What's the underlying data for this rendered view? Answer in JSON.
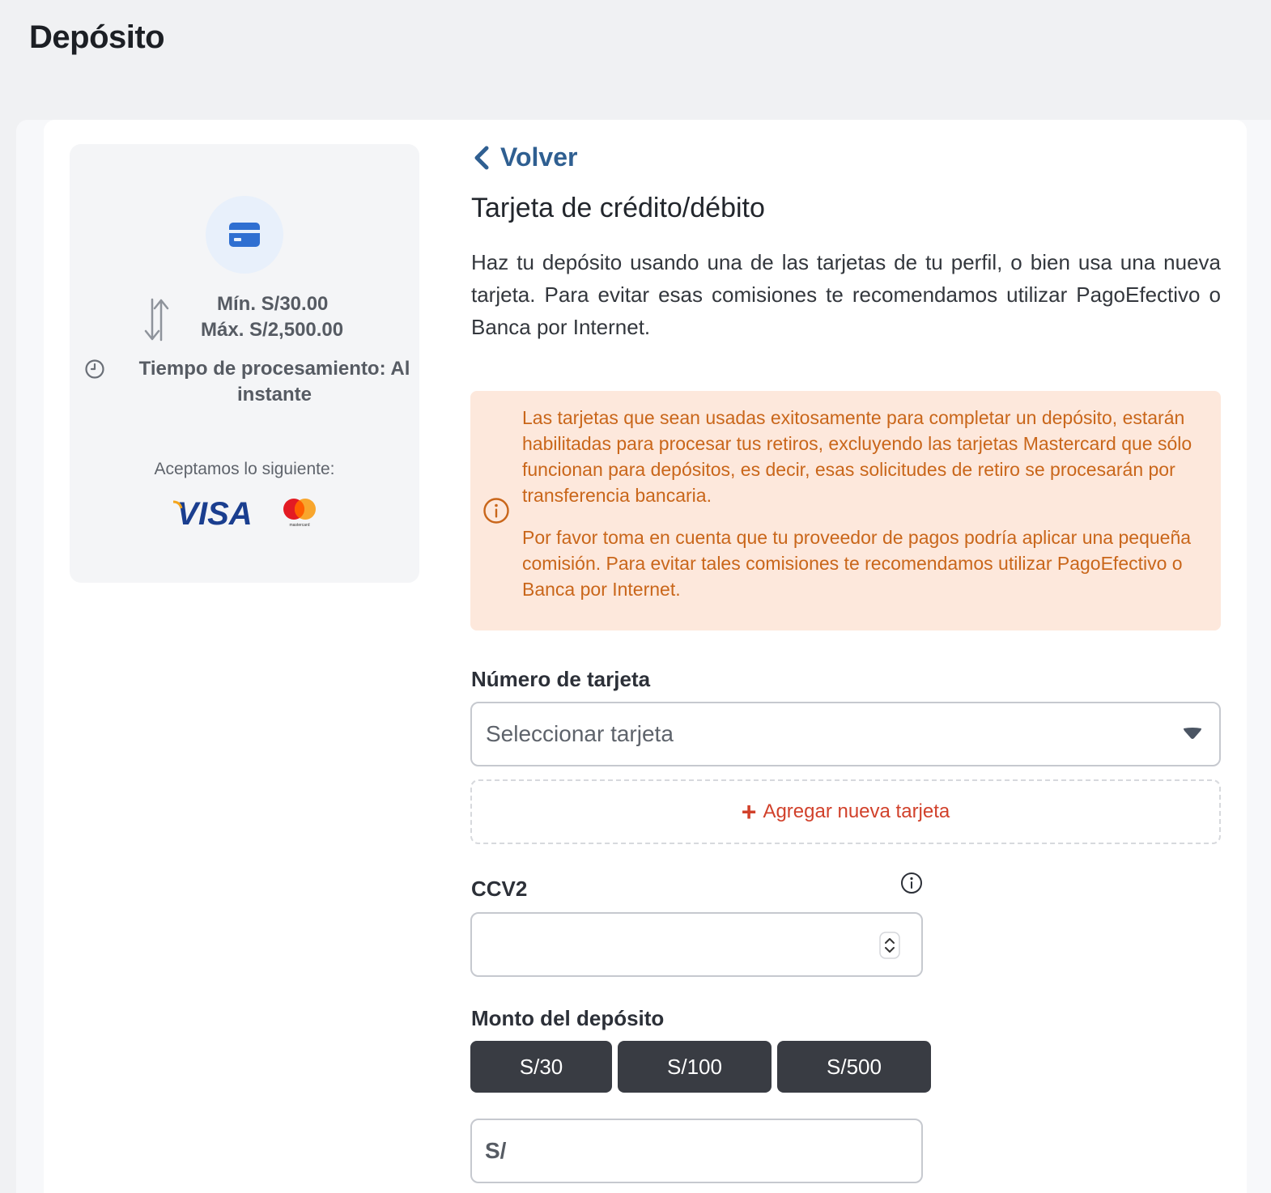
{
  "page": {
    "title": "Depósito"
  },
  "info": {
    "min": "Mín. S/30.00",
    "max": "Máx. S/2,500.00",
    "processing": "Tiempo de procesamiento: Al instante",
    "accept": "Aceptamos lo siguiente:",
    "brands": [
      "VISA",
      "mastercard"
    ]
  },
  "content": {
    "back": "Volver",
    "title": "Tarjeta de crédito/débito",
    "description": "Haz tu depósito usando una de las tarjetas de tu perfil, o bien usa una nueva tarjeta. Para evitar esas comisiones te recomendamos utilizar PagoEfectivo o Banca por Internet.",
    "notice": {
      "p1": "Las tarjetas que sean usadas exitosamente para completar un depósito, estarán habilitadas para procesar tus retiros, excluyendo las tarjetas Mastercard que sólo funcionan para depósitos, es decir, esas solicitudes de retiro se procesarán por transferencia bancaria.",
      "p2": "Por favor toma en cuenta que tu proveedor de pagos podría aplicar una pequeña comisión. Para evitar tales comisiones te recomendamos utilizar PagoEfectivo o Banca por Internet."
    }
  },
  "form": {
    "card_label": "Número de tarjeta",
    "card_placeholder": "Seleccionar tarjeta",
    "add_card": "Agregar nueva tarjeta",
    "ccv_label": "CCV2",
    "ccv_value": "",
    "amount_label": "Monto del depósito",
    "quick_amounts": [
      "S/30",
      "S/100",
      "S/500"
    ],
    "currency_prefix": "S/",
    "amount_value": ""
  },
  "colors": {
    "accent_link": "#2f5f91",
    "notice_bg": "#fde8dc",
    "notice_text": "#c9661a",
    "add_card": "#d1412b",
    "button_bg": "#393c43"
  },
  "icons": [
    "credit-card-icon",
    "arrows-up-down-icon",
    "clock-icon",
    "visa-logo",
    "mastercard-logo",
    "chevron-left-icon",
    "info-icon",
    "caret-down-icon",
    "plus-icon",
    "spinner-icon"
  ]
}
